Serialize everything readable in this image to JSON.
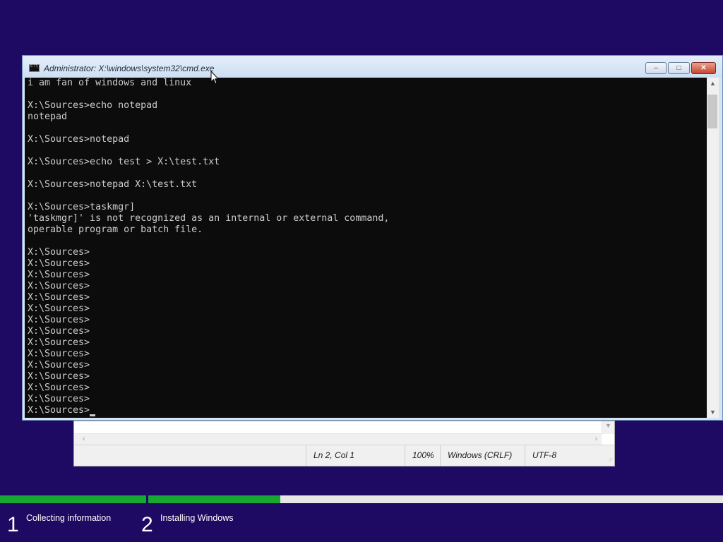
{
  "cmd_window": {
    "title": "Administrator: X:\\windows\\system32\\cmd.exe",
    "controls": {
      "minimize": "–",
      "maximize": "□",
      "close": "✕"
    },
    "console_lines": [
      "i am fan of windows and linux",
      "",
      "X:\\Sources>echo notepad",
      "notepad",
      "",
      "X:\\Sources>notepad",
      "",
      "X:\\Sources>echo test > X:\\test.txt",
      "",
      "X:\\Sources>notepad X:\\test.txt",
      "",
      "X:\\Sources>taskmgr]",
      "'taskmgr]' is not recognized as an internal or external command,",
      "operable program or batch file.",
      "",
      "X:\\Sources>",
      "X:\\Sources>",
      "X:\\Sources>",
      "X:\\Sources>",
      "X:\\Sources>",
      "X:\\Sources>",
      "X:\\Sources>",
      "X:\\Sources>",
      "X:\\Sources>",
      "X:\\Sources>",
      "X:\\Sources>",
      "X:\\Sources>",
      "X:\\Sources>",
      "X:\\Sources>",
      "X:\\Sources>"
    ],
    "scroll_up_icon": "chevron-up-icon",
    "scroll_down_icon": "chevron-down-icon"
  },
  "notepad": {
    "status": {
      "position": "Ln 2, Col 1",
      "zoom": "100%",
      "line_ending": "Windows (CRLF)",
      "encoding": "UTF-8"
    }
  },
  "setup": {
    "progress": [
      {
        "fill": 1.0
      },
      {
        "fill": 0.23
      }
    ],
    "steps": [
      {
        "number": "1",
        "label": "Collecting information"
      },
      {
        "number": "2",
        "label": "Installing Windows"
      }
    ],
    "colors": {
      "background": "#1e0a63",
      "progress": "#16a832"
    }
  }
}
